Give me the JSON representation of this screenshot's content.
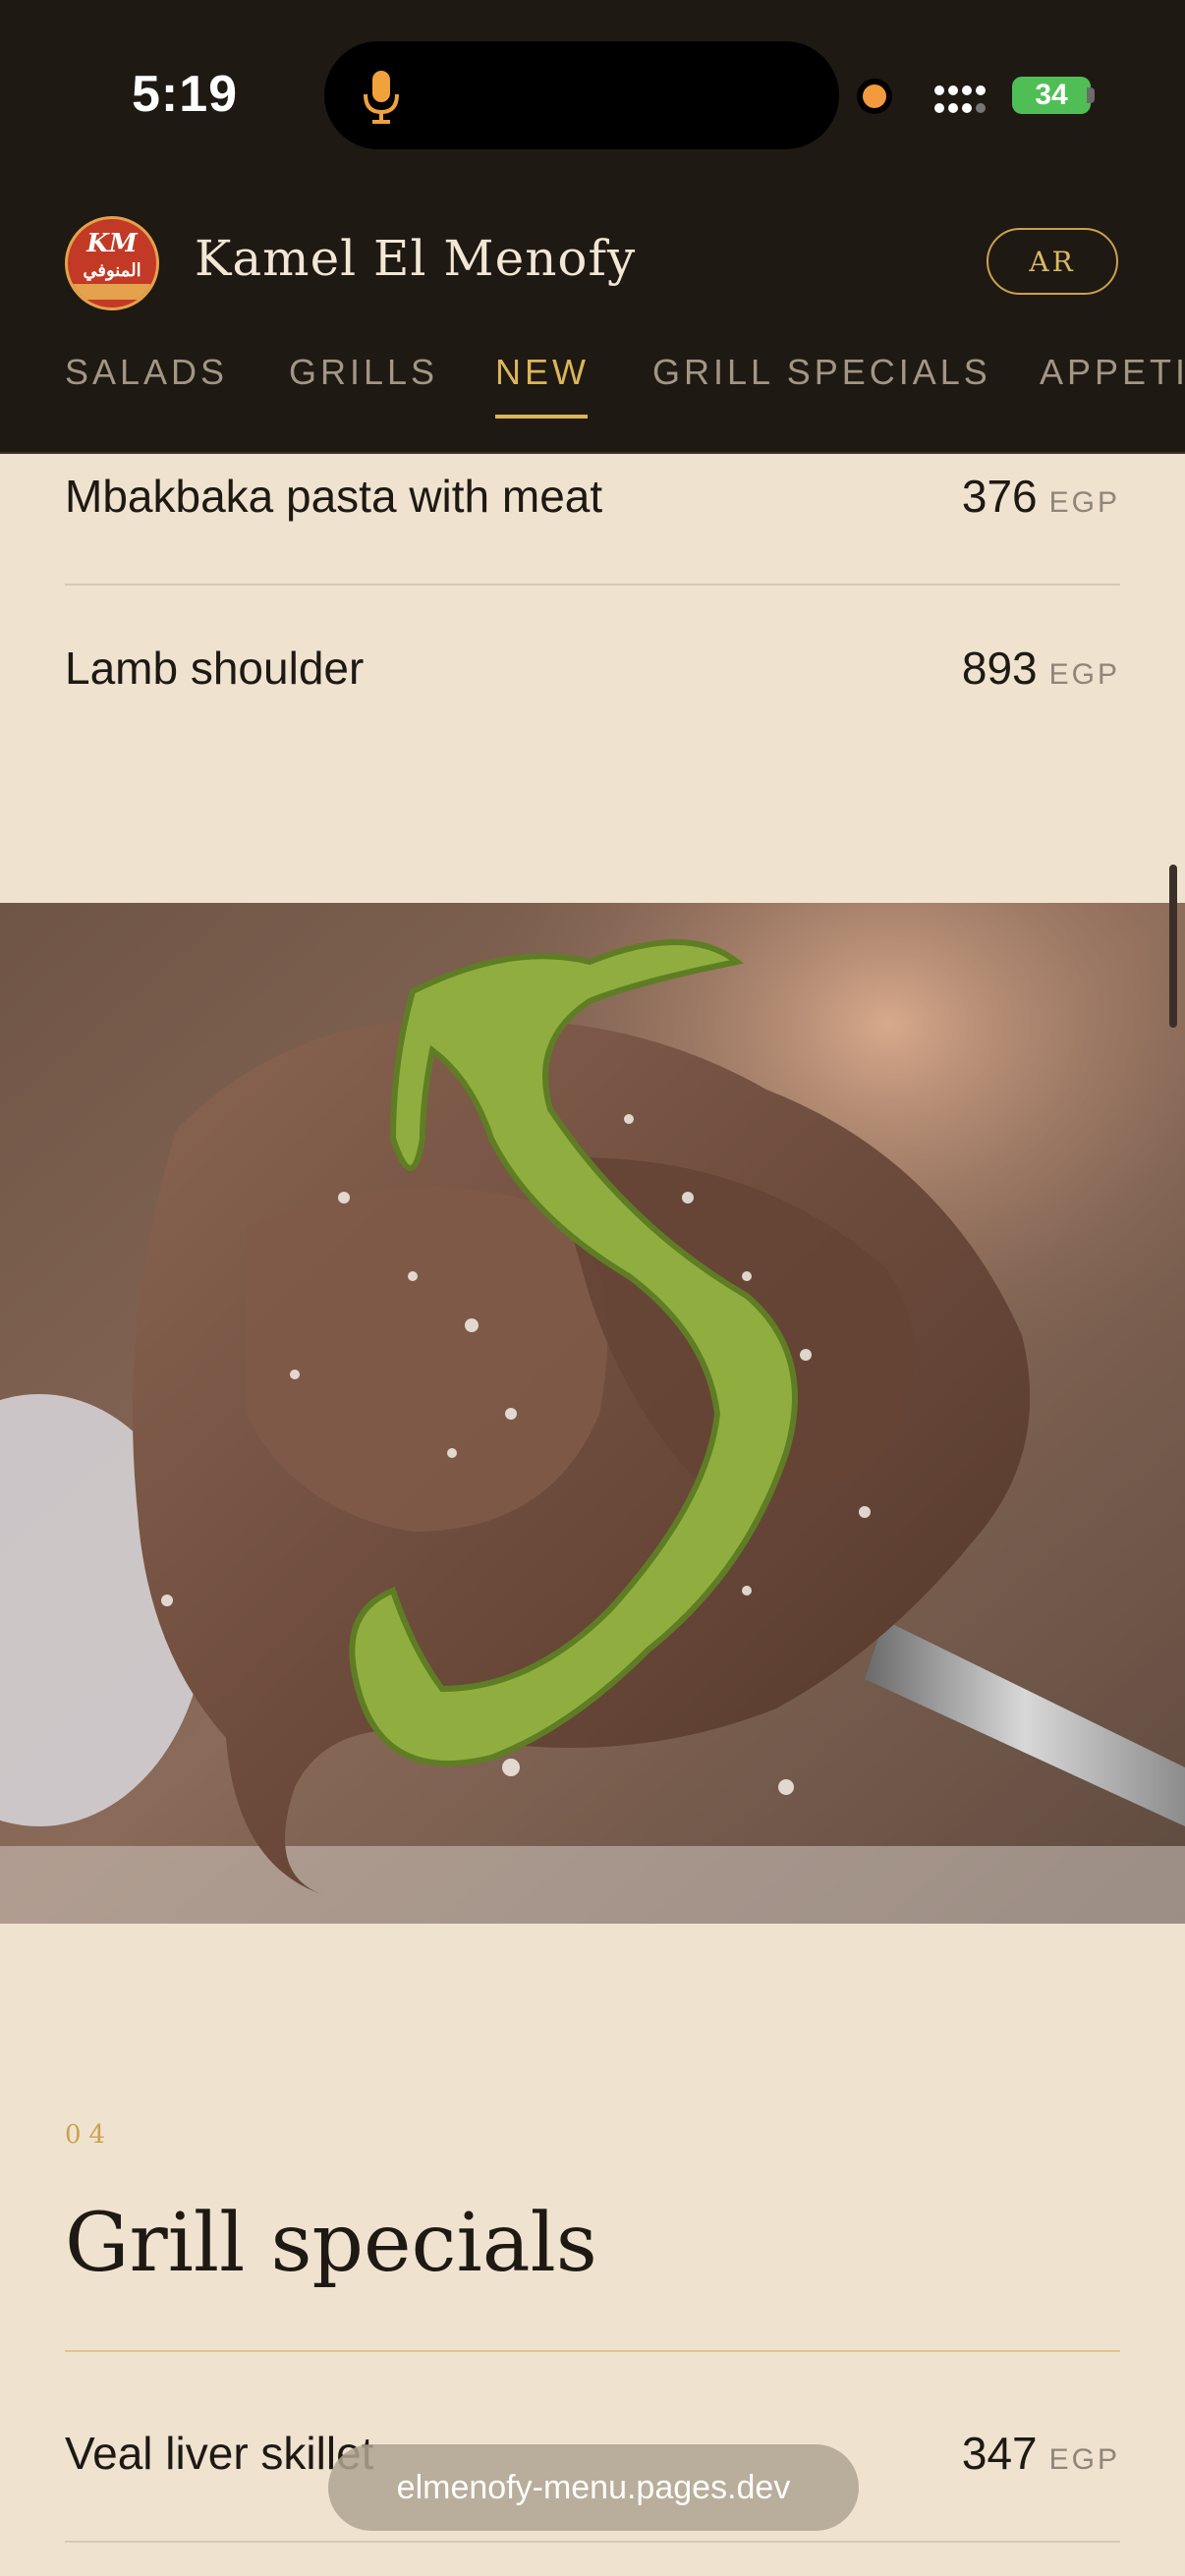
{
  "status_bar": {
    "time": "5:19",
    "battery": "34"
  },
  "header": {
    "logo_mark": "KM",
    "logo_text": "المنوفي",
    "brand": "Kamel El Menofy",
    "language_button": "AR"
  },
  "tabs": [
    {
      "label": "SALADS",
      "active": false
    },
    {
      "label": "GRILLS",
      "active": false
    },
    {
      "label": "NEW",
      "active": true
    },
    {
      "label": "GRILL SPECIALS",
      "active": false
    },
    {
      "label": "APPETI",
      "active": false
    }
  ],
  "new_items": [
    {
      "name": "Mbakbaka pasta with meat",
      "price": "376",
      "currency": "EGP"
    },
    {
      "name": "Lamb shoulder",
      "price": "893",
      "currency": "EGP"
    }
  ],
  "grill_specials": {
    "number": "04",
    "title": "Grill specials",
    "items": [
      {
        "name": "Veal liver skillet",
        "price": "347",
        "currency": "EGP"
      }
    ]
  },
  "browser": {
    "url": "elmenofy-menu.pages.dev"
  },
  "colors": {
    "header_bg": "#1f1914",
    "page_bg": "#efe3d0",
    "accent_gold": "#dcb558",
    "logo_red": "#c23a26"
  }
}
